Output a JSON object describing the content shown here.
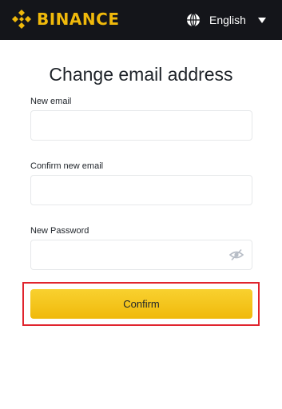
{
  "header": {
    "brand": "BINANCE",
    "brand_color": "#f0b90b",
    "background_color": "#14151a",
    "language": {
      "label": "English",
      "icon": "globe-icon",
      "caret_icon": "caret-down-icon"
    }
  },
  "form": {
    "title": "Change email address",
    "fields": [
      {
        "label": "New email",
        "value": "",
        "placeholder": ""
      },
      {
        "label": "Confirm new email",
        "value": "",
        "placeholder": ""
      },
      {
        "label": "New Password",
        "value": "",
        "placeholder": "",
        "toggle_icon": "eye-slash-icon"
      }
    ],
    "confirm_label": "Confirm",
    "button_color": "#f0b90b",
    "highlight_color": "#e0242d"
  }
}
